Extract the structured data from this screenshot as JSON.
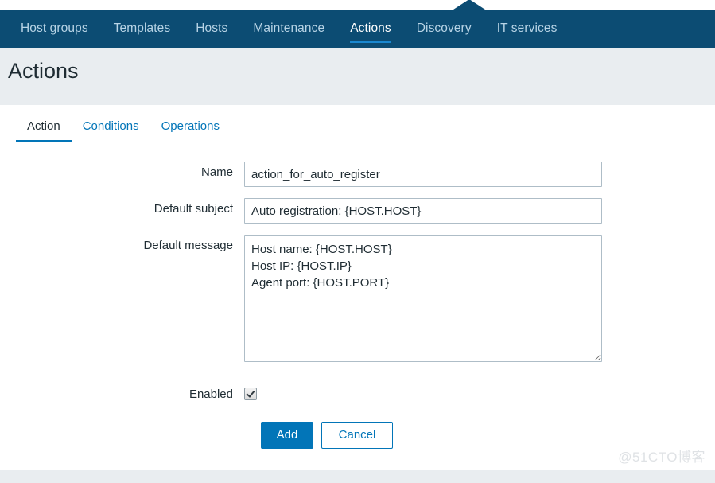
{
  "navbar": {
    "items": [
      {
        "label": "Host groups",
        "active": false
      },
      {
        "label": "Templates",
        "active": false
      },
      {
        "label": "Hosts",
        "active": false
      },
      {
        "label": "Maintenance",
        "active": false
      },
      {
        "label": "Actions",
        "active": true
      },
      {
        "label": "Discovery",
        "active": false
      },
      {
        "label": "IT services",
        "active": false
      }
    ],
    "background_color": "#0c4c73",
    "active_underline_color": "#1a88d0"
  },
  "header": {
    "title": "Actions",
    "background_color": "#e9edf0"
  },
  "tabs": [
    {
      "label": "Action",
      "active": true
    },
    {
      "label": "Conditions",
      "active": false
    },
    {
      "label": "Operations",
      "active": false
    }
  ],
  "form": {
    "name": {
      "label": "Name",
      "value": "action_for_auto_register",
      "placeholder": ""
    },
    "default_subject": {
      "label": "Default subject",
      "value": "Auto registration: {HOST.HOST}",
      "placeholder": ""
    },
    "default_message": {
      "label": "Default message",
      "value": "Host name: {HOST.HOST}\nHost IP: {HOST.IP}\nAgent port: {HOST.PORT}",
      "placeholder": ""
    },
    "enabled": {
      "label": "Enabled",
      "checked": true
    }
  },
  "buttons": {
    "add_label": "Add",
    "cancel_label": "Cancel",
    "primary_color": "#0275b8"
  },
  "watermark": {
    "text": "@51CTO博客"
  }
}
